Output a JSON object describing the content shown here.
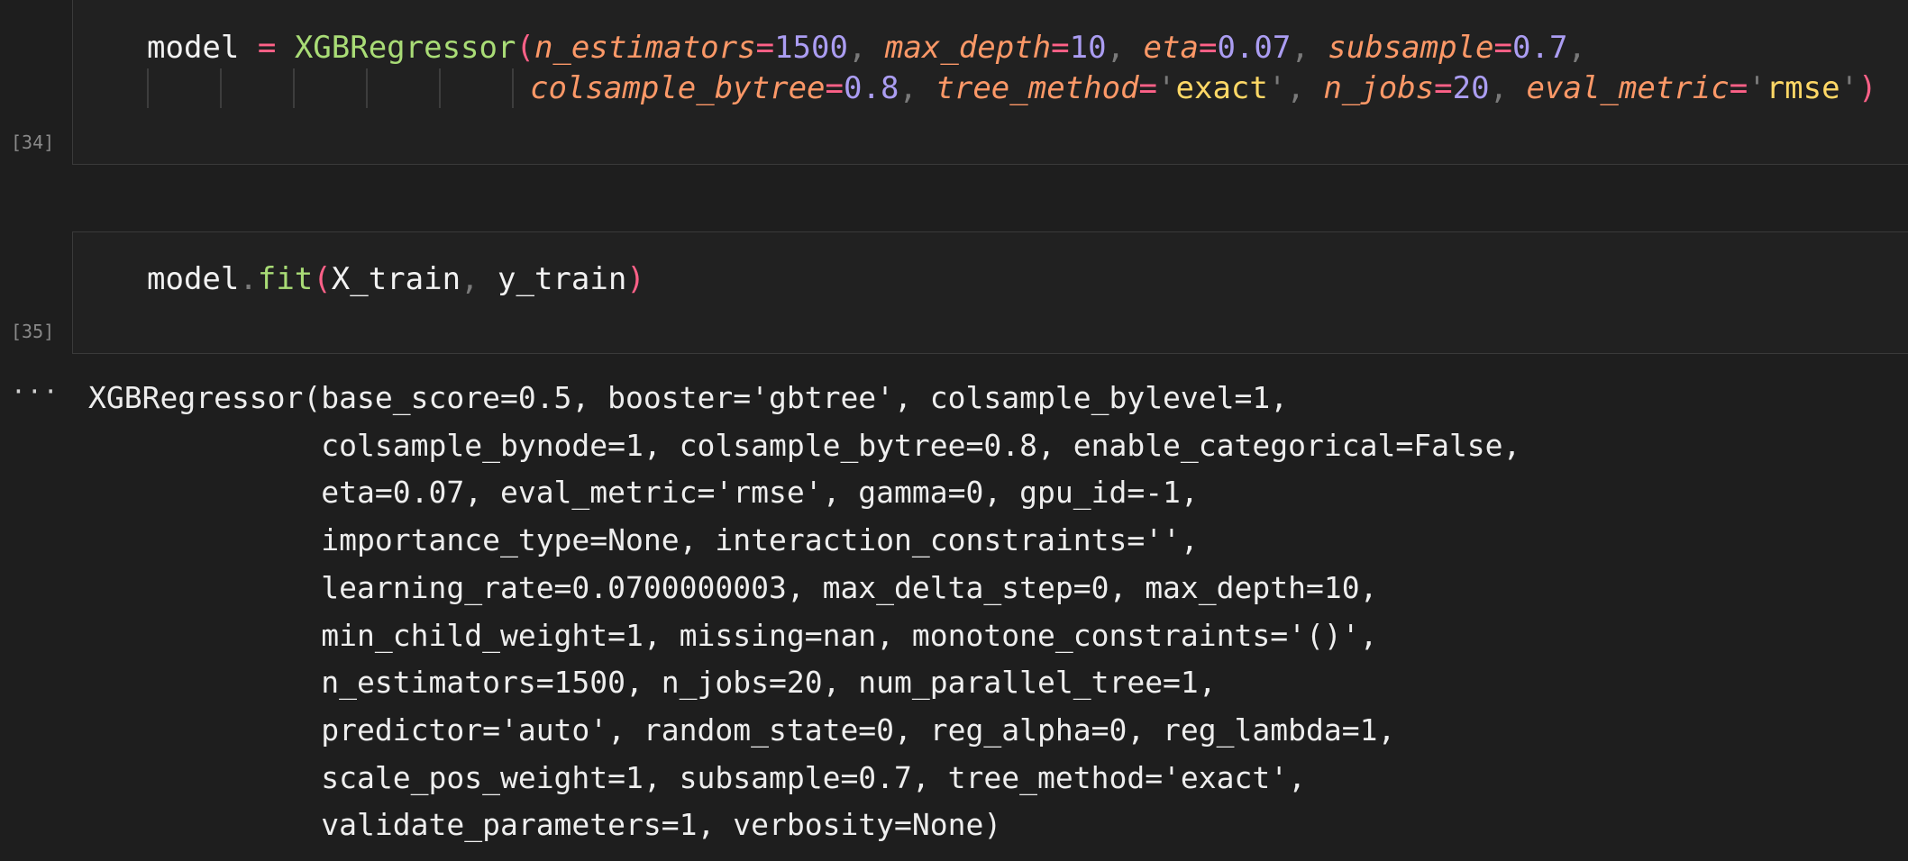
{
  "cells": [
    {
      "execution_count": "[34]",
      "code_lines": [
        [
          {
            "t": "model",
            "c": "plain"
          },
          {
            "t": " ",
            "c": "plain"
          },
          {
            "t": "=",
            "c": "op"
          },
          {
            "t": " ",
            "c": "plain"
          },
          {
            "t": "XGBRegressor",
            "c": "fn"
          },
          {
            "t": "(",
            "c": "paren"
          },
          {
            "t": "n_estimators",
            "c": "param"
          },
          {
            "t": "=",
            "c": "op"
          },
          {
            "t": "1500",
            "c": "num"
          },
          {
            "t": ", ",
            "c": "punct"
          },
          {
            "t": "max_depth",
            "c": "param"
          },
          {
            "t": "=",
            "c": "op"
          },
          {
            "t": "10",
            "c": "num"
          },
          {
            "t": ", ",
            "c": "punct"
          },
          {
            "t": "eta",
            "c": "param"
          },
          {
            "t": "=",
            "c": "op"
          },
          {
            "t": "0.07",
            "c": "num"
          },
          {
            "t": ", ",
            "c": "punct"
          },
          {
            "t": "subsample",
            "c": "param"
          },
          {
            "t": "=",
            "c": "op"
          },
          {
            "t": "0.7",
            "c": "num"
          },
          {
            "t": ",",
            "c": "punct"
          }
        ],
        [
          {
            "t": "colsample_bytree",
            "c": "param"
          },
          {
            "t": "=",
            "c": "op"
          },
          {
            "t": "0.8",
            "c": "num"
          },
          {
            "t": ", ",
            "c": "punct"
          },
          {
            "t": "tree_method",
            "c": "param"
          },
          {
            "t": "=",
            "c": "op"
          },
          {
            "t": "'",
            "c": "punct"
          },
          {
            "t": "exact",
            "c": "str"
          },
          {
            "t": "'",
            "c": "punct"
          },
          {
            "t": ", ",
            "c": "punct"
          },
          {
            "t": "n_jobs",
            "c": "param"
          },
          {
            "t": "=",
            "c": "op"
          },
          {
            "t": "20",
            "c": "num"
          },
          {
            "t": ", ",
            "c": "punct"
          },
          {
            "t": "eval_metric",
            "c": "param"
          },
          {
            "t": "=",
            "c": "op"
          },
          {
            "t": "'",
            "c": "punct"
          },
          {
            "t": "rmse",
            "c": "str"
          },
          {
            "t": "'",
            "c": "punct"
          },
          {
            "t": ")",
            "c": "paren"
          }
        ]
      ]
    },
    {
      "execution_count": "[35]",
      "code_lines": [
        [
          {
            "t": "model",
            "c": "plain"
          },
          {
            "t": ".",
            "c": "dot"
          },
          {
            "t": "fit",
            "c": "fn"
          },
          {
            "t": "(",
            "c": "paren"
          },
          {
            "t": "X_train",
            "c": "plain"
          },
          {
            "t": ", ",
            "c": "punct"
          },
          {
            "t": "y_train",
            "c": "plain"
          },
          {
            "t": ")",
            "c": "paren"
          }
        ]
      ]
    }
  ],
  "output": {
    "marker": "···",
    "lines": [
      "XGBRegressor(base_score=0.5, booster='gbtree', colsample_bylevel=1,",
      "             colsample_bynode=1, colsample_bytree=0.8, enable_categorical=False,",
      "             eta=0.07, eval_metric='rmse', gamma=0, gpu_id=-1,",
      "             importance_type=None, interaction_constraints='',",
      "             learning_rate=0.0700000003, max_delta_step=0, max_depth=10,",
      "             min_child_weight=1, missing=nan, monotone_constraints='()',",
      "             n_estimators=1500, n_jobs=20, num_parallel_tree=1,",
      "             predictor='auto', random_state=0, reg_alpha=0, reg_lambda=1,",
      "             scale_pos_weight=1, subsample=0.7, tree_method='exact',",
      "             validate_parameters=1, verbosity=None)"
    ]
  },
  "colors": {
    "background": "#1e1e1e",
    "cell_background": "#212121",
    "operator": "#ff6188",
    "function": "#a9dc76",
    "parameter": "#fc9867",
    "number": "#ab9df2",
    "string": "#ffd866"
  }
}
